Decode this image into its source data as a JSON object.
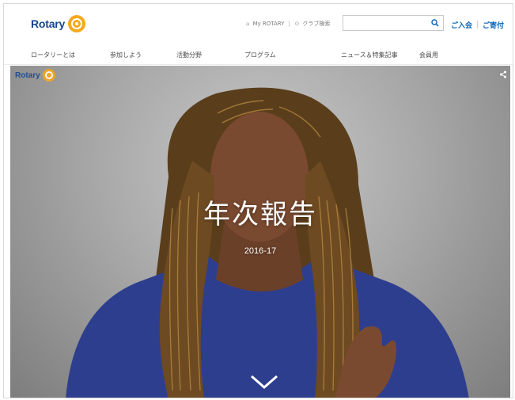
{
  "header": {
    "logo_text": "Rotary",
    "util_my_rotary": "My ROTARY",
    "util_club_search": "クラブ検索",
    "search_placeholder": "",
    "join_label": "ご入会",
    "donate_label": "ご寄付"
  },
  "nav": {
    "items": [
      {
        "label": "ロータリーとは"
      },
      {
        "label": "参加しよう"
      },
      {
        "label": "活動分野"
      },
      {
        "label": "プログラム"
      },
      {
        "label": "ニュース＆特集記事"
      },
      {
        "label": "会員用"
      }
    ]
  },
  "hero": {
    "logo_text": "Rotary",
    "title": "年次報告",
    "subtitle": "2016-17"
  },
  "colors": {
    "brand_blue": "#17458f",
    "brand_gold": "#f7a81b",
    "link_blue": "#0a63b7",
    "sweater": "#2e3e8e"
  },
  "icons": [
    "rotary-wheel-icon",
    "home-icon",
    "pin-icon",
    "search-icon",
    "share-icon",
    "chevron-down-icon"
  ]
}
